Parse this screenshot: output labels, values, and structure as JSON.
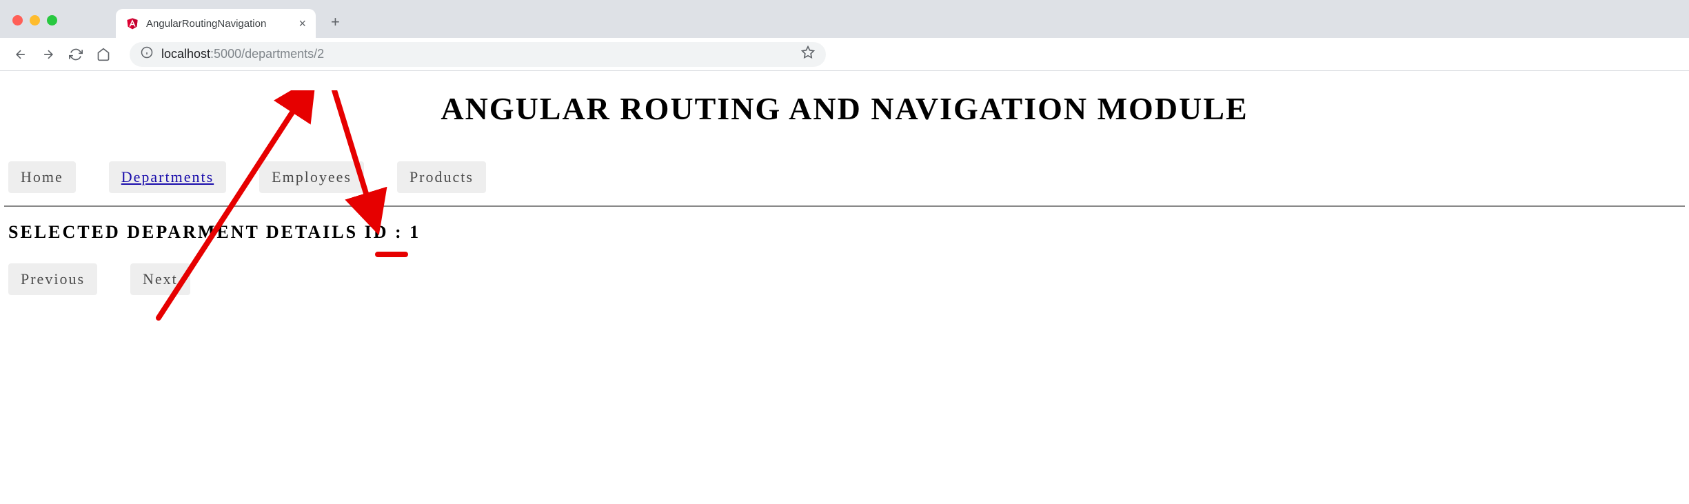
{
  "browser": {
    "tab_title": "AngularRoutingNavigation",
    "url_host": "localhost",
    "url_rest": ":5000/departments/2"
  },
  "page": {
    "title": "ANGULAR ROUTING AND NAVIGATION MODULE",
    "nav": {
      "home": "Home",
      "departments": "Departments",
      "employees": "Employees",
      "products": "Products"
    },
    "detail_label": "SELECTED DEPARMENT DETAILS ID : ",
    "detail_id": "1",
    "prev": "Previous",
    "next": "Next"
  }
}
